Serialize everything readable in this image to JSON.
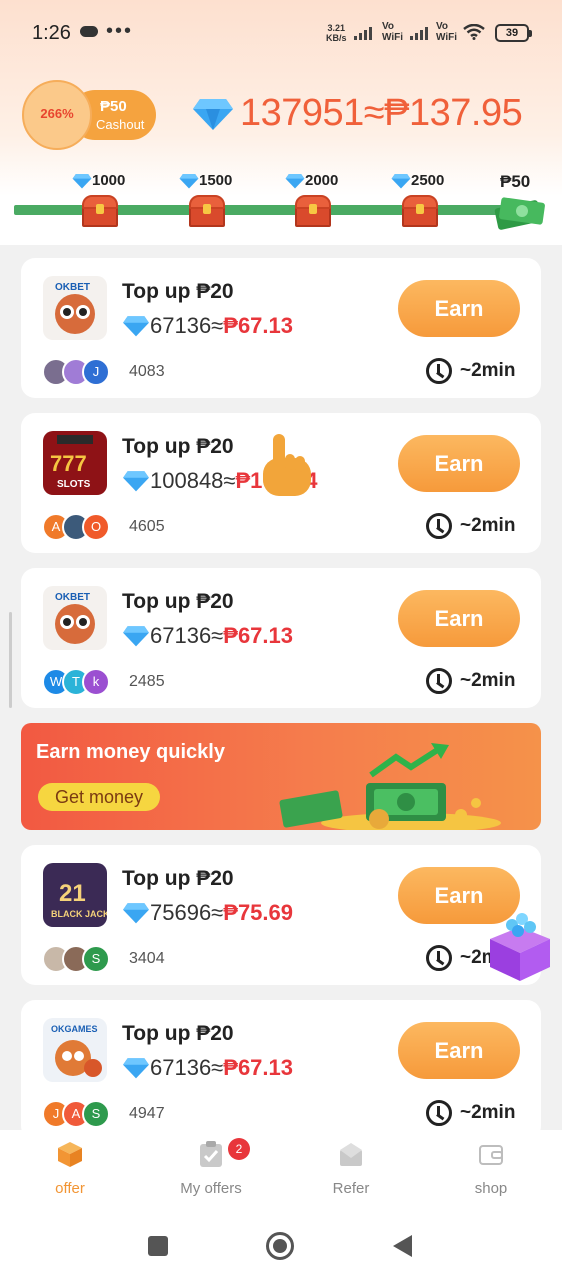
{
  "status_bar": {
    "time": "1:26",
    "speed_value": "3.21",
    "speed_unit": "KB/s",
    "sim1_label": "Vo\nWiFi",
    "sim2_label": "Vo\nWiFi",
    "battery": "39"
  },
  "header": {
    "cashout_percent": "266%",
    "cashout_amount": "₱50",
    "cashout_label": "Cashout",
    "balance": "137951≈₱137.95"
  },
  "milestones": [
    {
      "label": "1000"
    },
    {
      "label": "1500"
    },
    {
      "label": "2000"
    },
    {
      "label": "2500"
    },
    {
      "label": "₱50"
    }
  ],
  "offers": [
    {
      "title": "Top up ₱20",
      "gems": "67136≈",
      "peso": "₱67.13",
      "earn": "Earn",
      "count": "4083",
      "time": "~2min",
      "icon": "okbet-app-icon",
      "avatars": [
        "",
        "",
        "J"
      ]
    },
    {
      "title": "Top up ₱20",
      "gems": "100848≈",
      "peso": "₱100.84",
      "earn": "Earn",
      "count": "4605",
      "time": "~2min",
      "icon": "casino-slots-app-icon",
      "avatars": [
        "A",
        "",
        "O"
      ]
    },
    {
      "title": "Top up ₱20",
      "gems": "67136≈",
      "peso": "₱67.13",
      "earn": "Earn",
      "count": "2485",
      "time": "~2min",
      "icon": "okbet-app-icon",
      "avatars": [
        "W",
        "T",
        "k"
      ]
    },
    {
      "title": "Top up ₱20",
      "gems": "75696≈",
      "peso": "₱75.69",
      "earn": "Earn",
      "count": "3404",
      "time": "~2min",
      "icon": "blackjack-app-icon",
      "avatars": [
        "",
        "",
        "S"
      ]
    },
    {
      "title": "Top up ₱20",
      "gems": "67136≈",
      "peso": "₱67.13",
      "earn": "Earn",
      "count": "4947",
      "time": "~2min",
      "icon": "okgames-app-icon",
      "avatars": [
        "J",
        "A",
        "S"
      ]
    }
  ],
  "banner": {
    "title": "Earn money quickly",
    "button": "Get money"
  },
  "bottom_nav": {
    "items": [
      {
        "label": "offer",
        "icon": "offer-box-icon"
      },
      {
        "label": "My offers",
        "icon": "clipboard-check-icon"
      },
      {
        "label": "Refer",
        "icon": "refer-envelope-icon"
      },
      {
        "label": "shop",
        "icon": "wallet-icon"
      }
    ],
    "my_offers_badge": "2"
  },
  "colors": {
    "accent": "#f29534",
    "price_red": "#e8363b",
    "balance_orange": "#f0603a",
    "progress_green": "#4aaa63"
  }
}
